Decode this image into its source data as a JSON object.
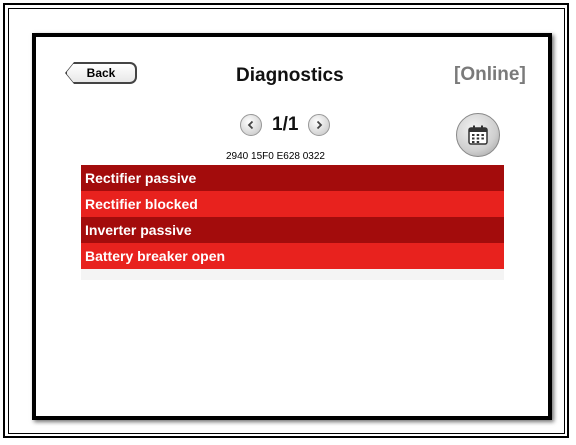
{
  "header": {
    "back_label": "Back",
    "title": "Diagnostics",
    "status": "[Online]"
  },
  "pager": {
    "prev_icon": "chevron-left-icon",
    "page": "1/1",
    "next_icon": "chevron-right-icon"
  },
  "calendar": {
    "icon": "calendar-icon"
  },
  "record_id": "2940 15F0 E628 0322",
  "diagnostics": [
    {
      "label": "Rectifier passive",
      "color": "#a30c0c"
    },
    {
      "label": "Rectifier blocked",
      "color": "#e8221e"
    },
    {
      "label": "Inverter passive",
      "color": "#a30c0c"
    },
    {
      "label": "Battery breaker open",
      "color": "#e8221e"
    }
  ]
}
